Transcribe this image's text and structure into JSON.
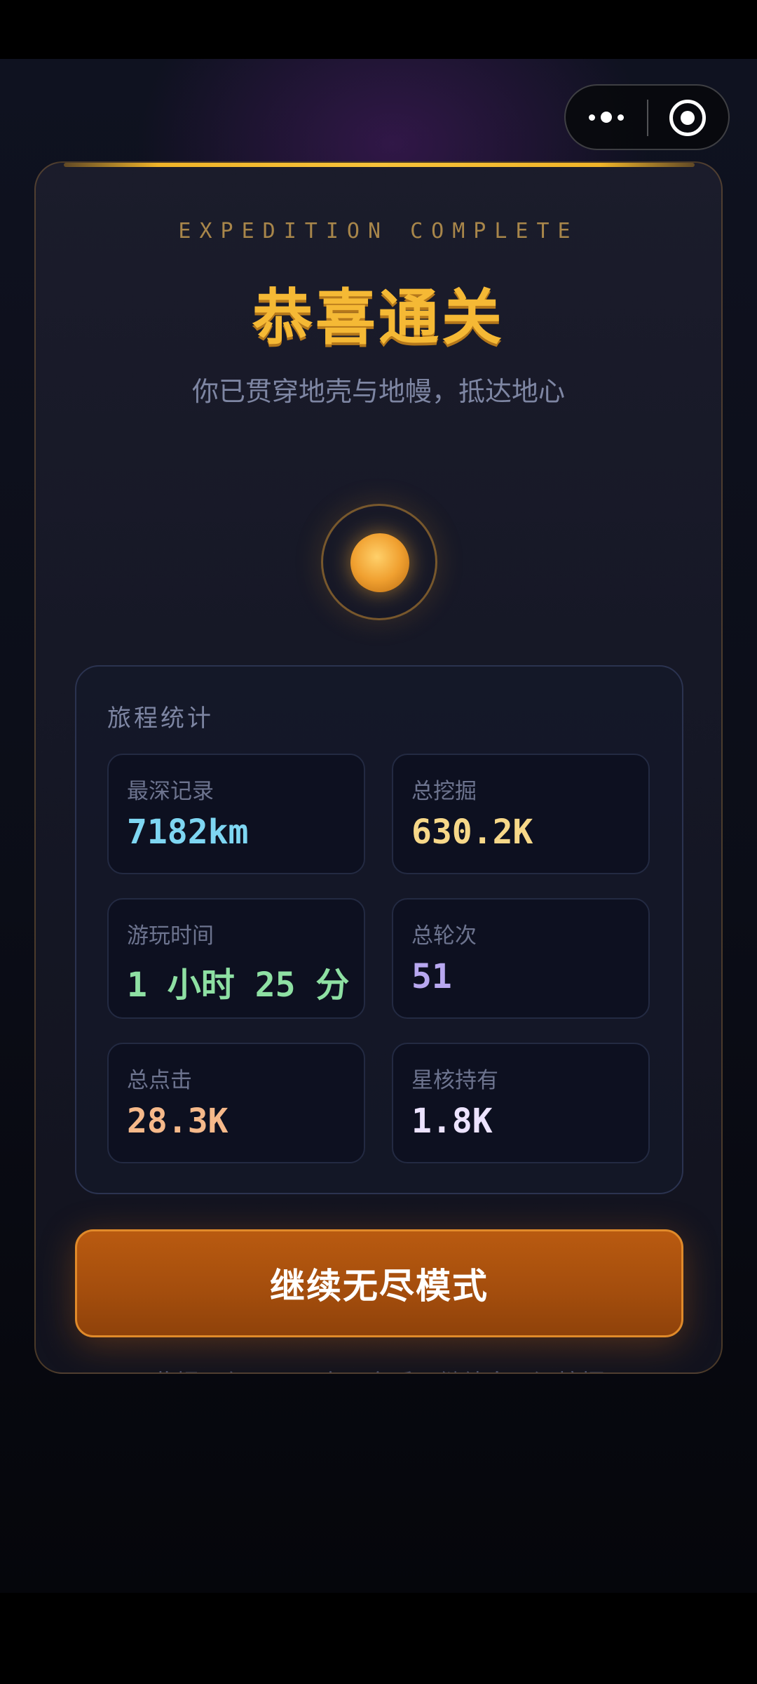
{
  "capsule": {
    "more_icon": "more-dots-icon",
    "close_icon": "target-close-icon"
  },
  "card": {
    "eyebrow": "EXPEDITION COMPLETE",
    "title": "恭喜通关",
    "subtitle": "你已贯穿地壳与地幔，抵达地心",
    "accent_color": "#f5b935"
  },
  "stats": {
    "title": "旅程统计",
    "items": [
      {
        "label": "最深记录",
        "value": "7182km",
        "color": "#7ed6f2"
      },
      {
        "label": "总挖掘",
        "value": "630.2K",
        "color": "#f7d889"
      },
      {
        "label": "游玩时间",
        "value": "1 小时 25 分",
        "color": "#8ee0a3"
      },
      {
        "label": "总轮次",
        "value": "51",
        "color": "#b8a8f0"
      },
      {
        "label": "总点击",
        "value": "28.3K",
        "color": "#f6b98a"
      },
      {
        "label": "星核持有",
        "value": "1.8K",
        "color": "#ece3ff"
      }
    ]
  },
  "cta": {
    "label": "继续无尽模式"
  },
  "footnote": "此提示仅显示一次，之后可继续向更深挖掘"
}
